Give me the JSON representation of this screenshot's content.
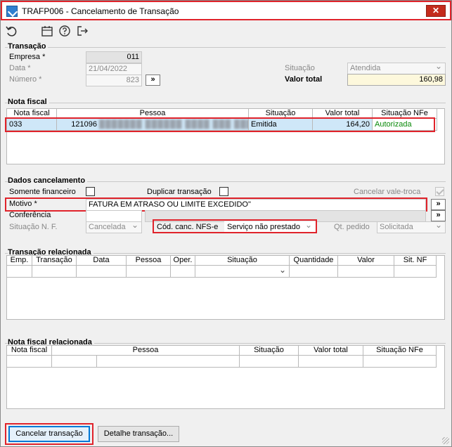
{
  "window": {
    "title": "TRAFP006 - Cancelamento de Transação",
    "close_label": "✕"
  },
  "toolbar": {
    "icons": [
      "undo-icon",
      "calendar-icon",
      "help-icon",
      "exit-icon"
    ]
  },
  "transacao": {
    "section_title": "Transação",
    "empresa_label": "Empresa *",
    "empresa_value": "011",
    "data_label": "Data *",
    "data_value": "21/04/2022",
    "numero_label": "Número *",
    "numero_value": "823",
    "situacao_label": "Situação",
    "situacao_value": "Atendida",
    "valor_total_label": "Valor total",
    "valor_total_value": "160,98",
    "lookup_label": "»"
  },
  "nota_fiscal": {
    "section_title": "Nota fiscal",
    "columns": [
      "Nota fiscal",
      "Pessoa",
      "Situação",
      "Valor total",
      "Situação NFe"
    ],
    "rows": [
      {
        "nota": "033",
        "pessoa_code": "121096",
        "pessoa_name": "███████ ██████ ████ ███ ██████",
        "situacao": "Emitida",
        "valor": "164,20",
        "situacao_nfe": "Autorizada"
      }
    ]
  },
  "cancelamento": {
    "section_title": "Dados cancelamento",
    "somente_financeiro_label": "Somente financeiro",
    "duplicar_label": "Duplicar transação",
    "cancelar_vale_label": "Cancelar vale-troca",
    "motivo_label": "Motivo *",
    "motivo_value": "FATURA EM ATRASO OU LIMITE EXCEDIDO\"",
    "conferencia_label": "Conferência",
    "conferencia_value": "",
    "situacao_nf_label": "Situação N. F.",
    "situacao_nf_value": "Cancelada",
    "cod_canc_label": "Cód. canc. NFS-e",
    "cod_canc_value": "Serviço não prestado",
    "qt_pedido_label": "Qt. pedido",
    "qt_pedido_value": "Solicitada",
    "lookup_label": "»"
  },
  "transacao_relacionada": {
    "section_title": "Transação relacionada",
    "columns": [
      "Emp.",
      "Transação",
      "Data",
      "Pessoa",
      "Oper.",
      "Situação",
      "Quantidade",
      "Valor",
      "Sit. NF"
    ]
  },
  "nota_fiscal_relacionada": {
    "section_title": "Nota fiscal relacionada",
    "columns": [
      "Nota fiscal",
      "Pessoa",
      "Situação",
      "Valor total",
      "Situação NFe"
    ]
  },
  "footer": {
    "cancelar_label": "Cancelar transação",
    "detalhe_label": "Detalhe transação..."
  },
  "colors": {
    "highlight": "#e0232b",
    "selected_row": "#cfe7f8",
    "authorized": "#0a8a0a",
    "primary_button": "#0078d7"
  }
}
